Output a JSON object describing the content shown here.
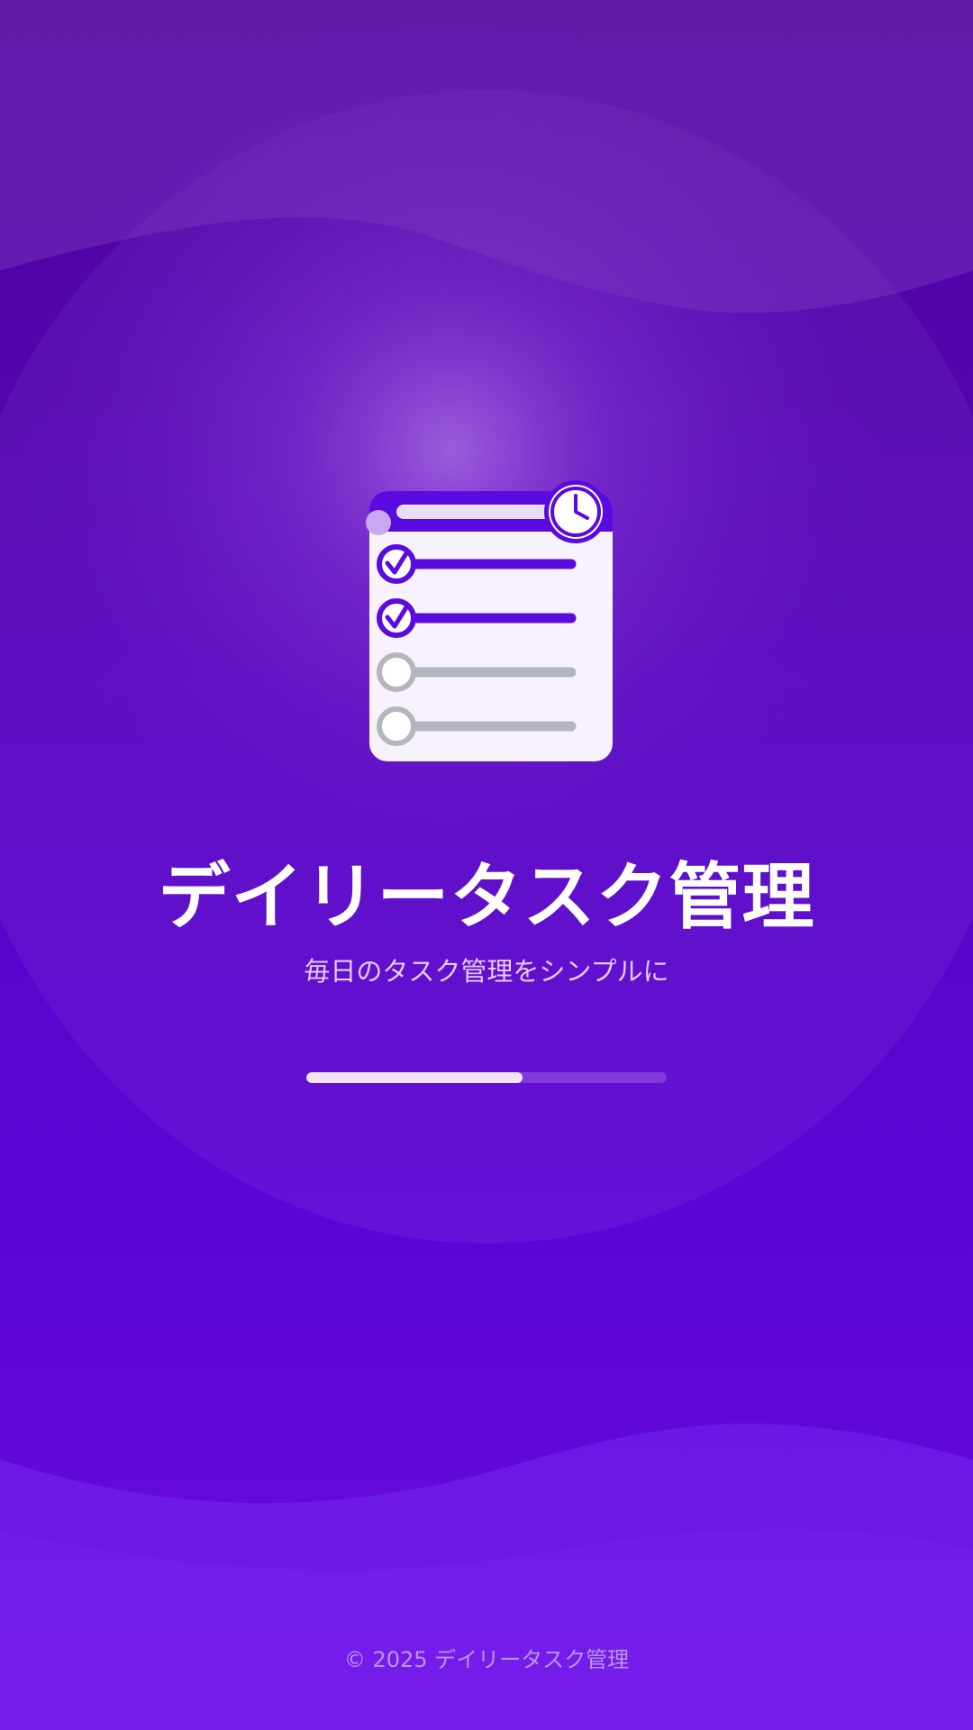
{
  "app": {
    "title": "デイリータスク管理",
    "subtitle": "毎日のタスク管理をシンプルに",
    "footer": "© 2025 デイリータスク管理"
  },
  "loading": {
    "progress": 0.6
  },
  "logo": {
    "icon": "task-checklist-clock-icon",
    "items": [
      {
        "checked": true
      },
      {
        "checked": true
      },
      {
        "checked": false
      },
      {
        "checked": false
      }
    ]
  },
  "colors": {
    "accent": "#5b0be0",
    "background_top": "#4e0497",
    "background_bottom": "#6a0ae0",
    "unchecked": "#b3b7bb",
    "text_primary": "#ffffff",
    "text_secondary": "#e2cdf7",
    "footer_text": "#b896ea"
  }
}
